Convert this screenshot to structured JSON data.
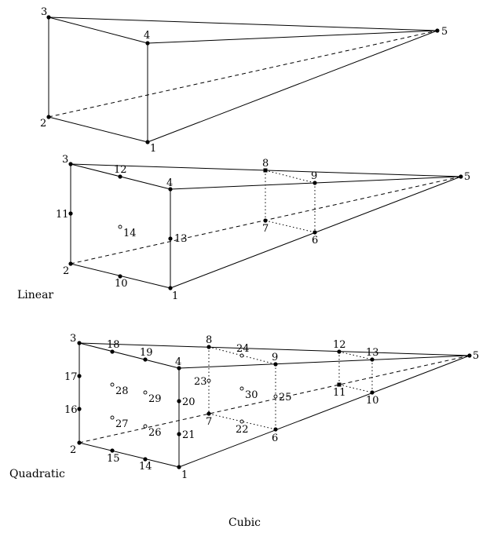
{
  "diagrams": [
    {
      "id": "vertices",
      "caption": "",
      "labels": [
        "1",
        "2",
        "3",
        "4",
        "5"
      ]
    },
    {
      "id": "linear",
      "caption": "Linear",
      "labels": [
        "1",
        "2",
        "3",
        "4",
        "5",
        "6",
        "7",
        "8",
        "9",
        "10",
        "11",
        "12",
        "13",
        "14"
      ]
    },
    {
      "id": "quadratic",
      "caption": "Quadratic",
      "labels": [
        "1",
        "2",
        "3",
        "4",
        "5",
        "6",
        "7",
        "8",
        "9",
        "10",
        "11",
        "12",
        "13",
        "14",
        "15",
        "16",
        "17",
        "18",
        "19",
        "20",
        "21",
        "22",
        "23",
        "24",
        "25",
        "26",
        "27",
        "28",
        "29",
        "30"
      ]
    }
  ],
  "footer_caption": "Cubic"
}
